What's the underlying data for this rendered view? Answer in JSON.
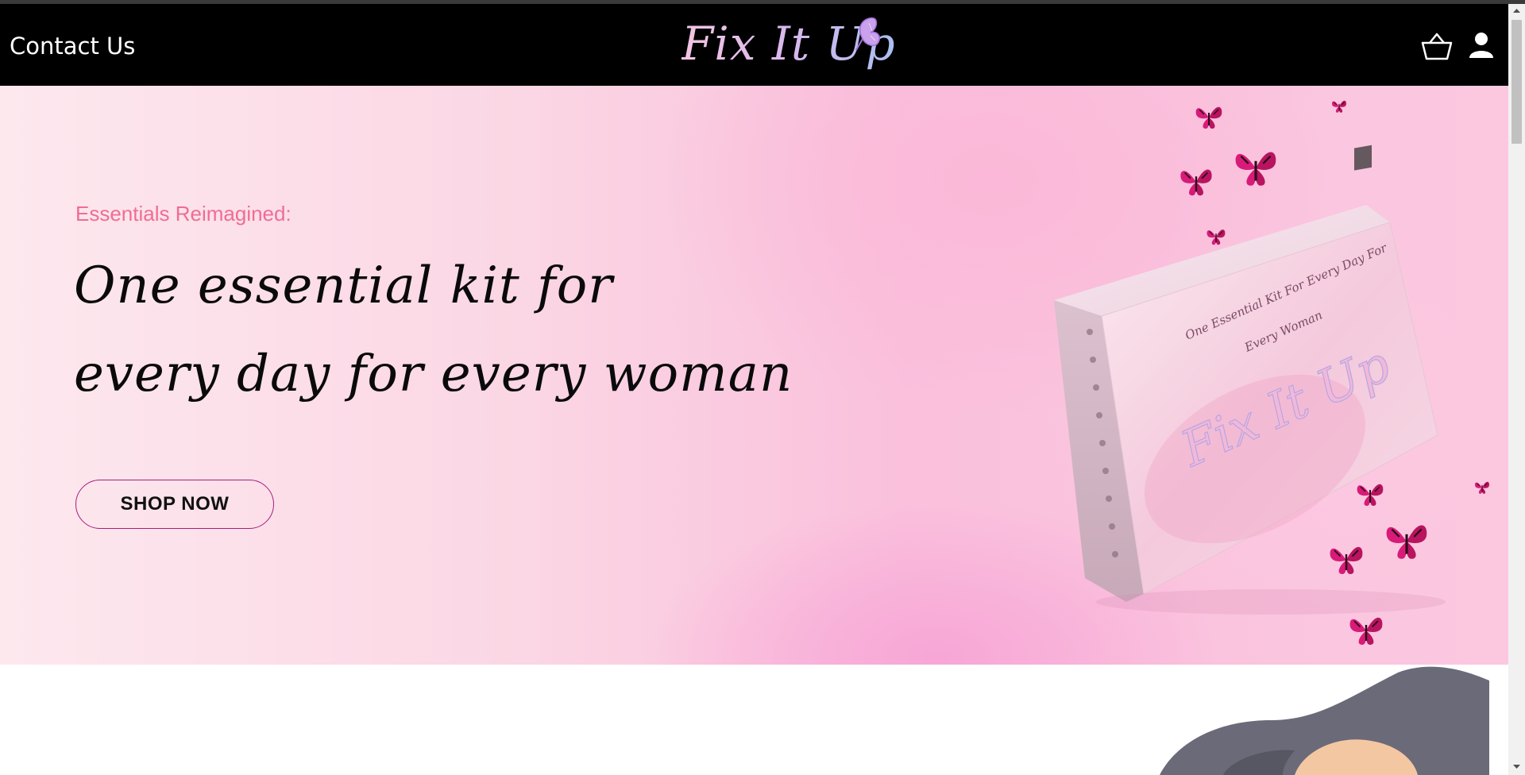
{
  "header": {
    "contact_label": "Contact Us",
    "logo_text": "Fix It Up",
    "icons": [
      "basket-icon",
      "user-icon",
      "butterfly-icon"
    ]
  },
  "hero": {
    "kicker": "Essentials Reimagined:",
    "headline_line1": "One essential kit for",
    "headline_line2": "every day for every woman",
    "cta_label": "SHOP NOW",
    "box_tagline_line1": "One Essential Kit For Every Day For",
    "box_tagline_line2": "Every Woman",
    "box_logo_text": "Fix It Up"
  },
  "colors": {
    "navbar": "#000000",
    "kicker": "#f06c96",
    "cta_border": "#a51e7a",
    "butterfly": "#d81b78",
    "hero_pink": "#fac0dc"
  }
}
